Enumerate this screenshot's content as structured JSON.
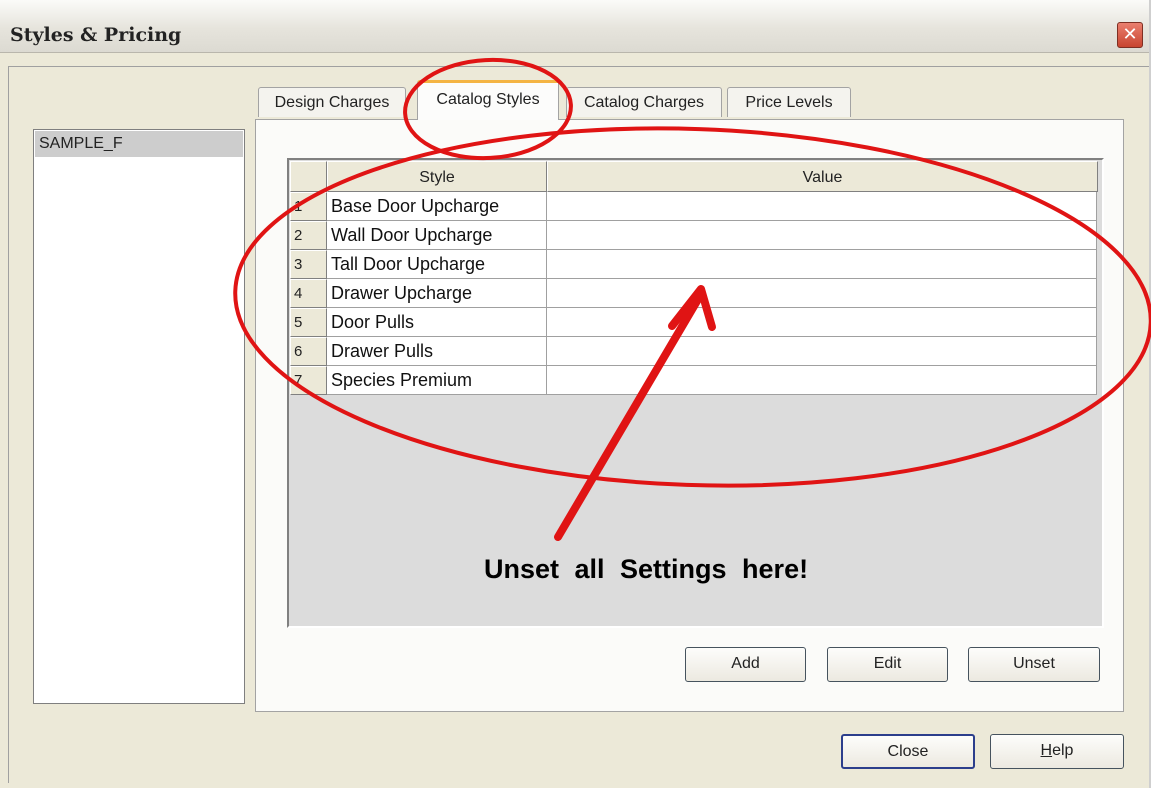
{
  "window": {
    "title": "Styles & Pricing",
    "close_glyph": "✕"
  },
  "left_list": {
    "items": [
      "SAMPLE_F"
    ]
  },
  "tabs": [
    {
      "label": "Design Charges",
      "active": false
    },
    {
      "label": "Catalog Styles",
      "active": true
    },
    {
      "label": "Catalog Charges",
      "active": false
    },
    {
      "label": "Price Levels",
      "active": false
    }
  ],
  "grid": {
    "headers": {
      "style": "Style",
      "value": "Value"
    },
    "rows": [
      {
        "num": "1",
        "style": "Base Door Upcharge",
        "value": ""
      },
      {
        "num": "2",
        "style": "Wall Door Upcharge",
        "value": ""
      },
      {
        "num": "3",
        "style": "Tall Door Upcharge",
        "value": ""
      },
      {
        "num": "4",
        "style": "Drawer Upcharge",
        "value": ""
      },
      {
        "num": "5",
        "style": "Door Pulls",
        "value": ""
      },
      {
        "num": "6",
        "style": "Drawer Pulls",
        "value": ""
      },
      {
        "num": "7",
        "style": "Species Premium",
        "value": ""
      }
    ]
  },
  "panel_buttons": {
    "add": "Add",
    "edit": "Edit",
    "unset": "Unset"
  },
  "dialog_buttons": {
    "close": "Close",
    "help": "Help",
    "help_mnemonic": "H",
    "help_rest": "elp"
  },
  "annotation": {
    "text": "Unset all Settings here!",
    "color": "#e01414"
  }
}
